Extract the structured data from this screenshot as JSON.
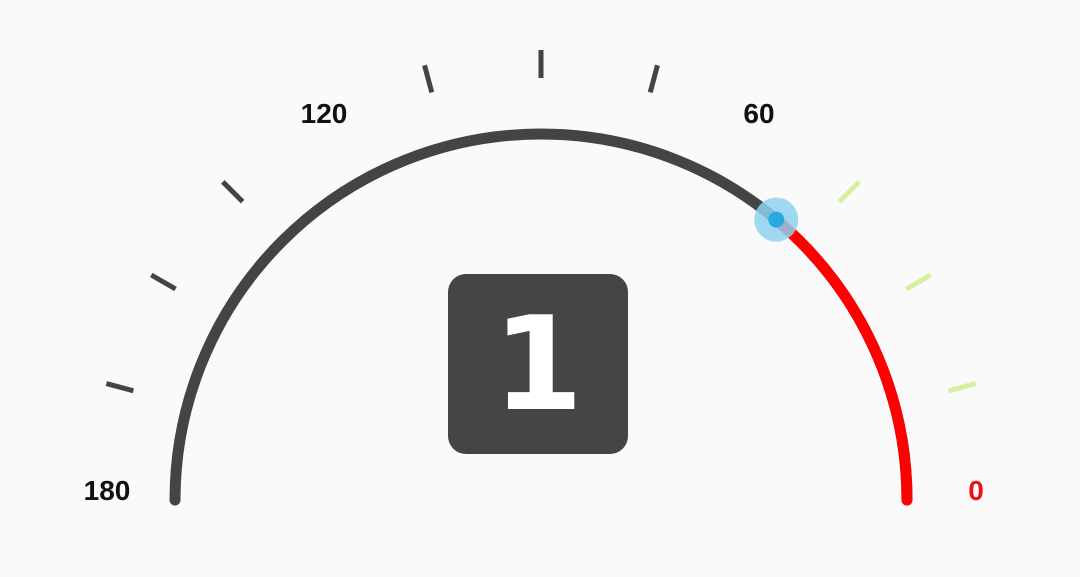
{
  "gauge": {
    "min": 0,
    "max": 180,
    "value": 50,
    "display_value": "1",
    "labels": [
      {
        "text": "180",
        "value": 180
      },
      {
        "text": "120",
        "value": 120
      },
      {
        "text": "60",
        "value": 60
      },
      {
        "text": "0",
        "value": 0
      }
    ],
    "colors": {
      "track": "#444444",
      "active_range": "#ff0000",
      "tick_dark": "#444444",
      "tick_light": "#d4f0a0",
      "label_default": "#111111",
      "label_active": "#ee1111",
      "knob": "#2aa8e0",
      "knob_halo": "#8fd0ef",
      "value_box": "#454545",
      "value_text": "#ffffff"
    }
  }
}
